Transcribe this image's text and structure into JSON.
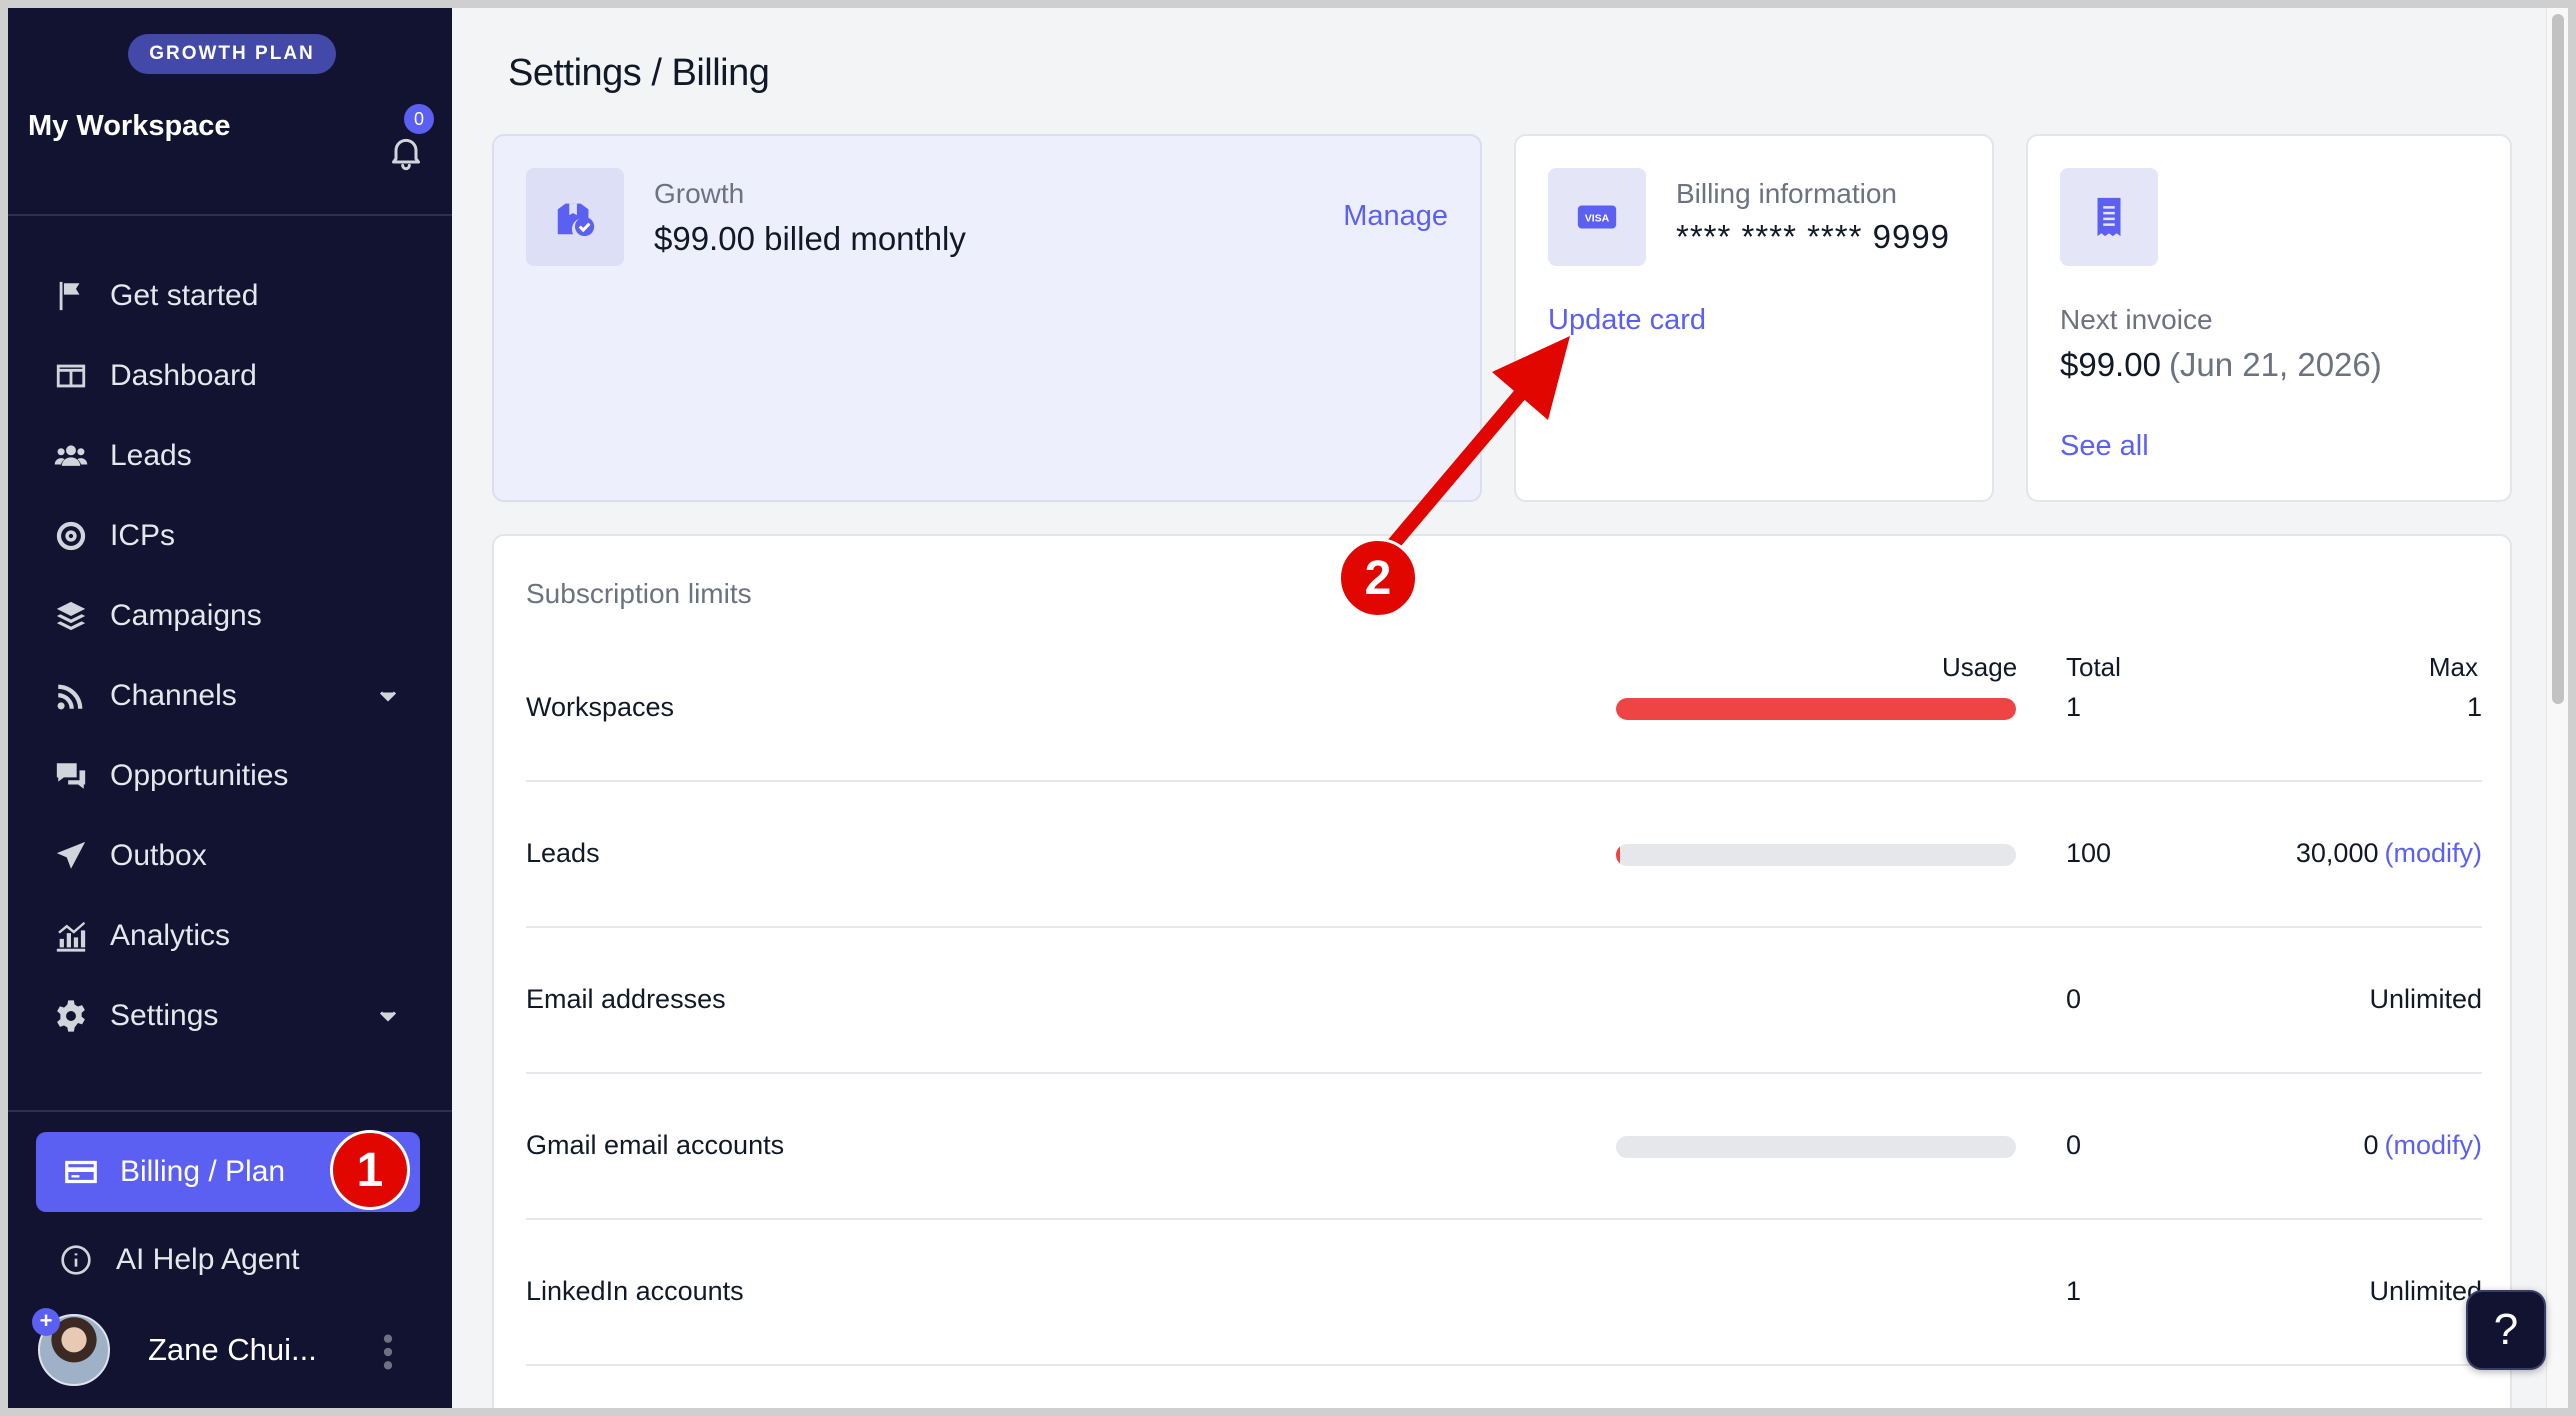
{
  "sidebar": {
    "plan_badge": "GROWTH PLAN",
    "workspace_name": "My Workspace",
    "notification_count": "0",
    "items": [
      {
        "label": "Get started",
        "icon": "flag-icon"
      },
      {
        "label": "Dashboard",
        "icon": "dashboard-icon"
      },
      {
        "label": "Leads",
        "icon": "users-icon"
      },
      {
        "label": "ICPs",
        "icon": "target-icon"
      },
      {
        "label": "Campaigns",
        "icon": "layers-icon"
      },
      {
        "label": "Channels",
        "icon": "rss-icon",
        "expandable": true
      },
      {
        "label": "Opportunities",
        "icon": "chat-icon"
      },
      {
        "label": "Outbox",
        "icon": "send-icon"
      },
      {
        "label": "Analytics",
        "icon": "analytics-icon"
      },
      {
        "label": "Settings",
        "icon": "gear-icon",
        "expandable": true
      }
    ],
    "billing_label": "Billing / Plan",
    "help_agent_label": "AI Help Agent",
    "user_name": "Zane Chui..."
  },
  "main": {
    "title": "Settings / Billing",
    "plan_card": {
      "plan_name": "Growth",
      "price": "$99.00 billed monthly",
      "manage_label": "Manage"
    },
    "billing_card": {
      "title": "Billing information",
      "card_number": "**** **** **** 9999",
      "update_label": "Update card"
    },
    "invoice_card": {
      "title": "Next invoice",
      "amount": "$99.00",
      "date": "(Jun 21, 2026)",
      "see_all_label": "See all"
    },
    "limits": {
      "title": "Subscription limits",
      "columns": {
        "usage": "Usage",
        "total": "Total",
        "max": "Max"
      },
      "rows": [
        {
          "label": "Workspaces",
          "usage": 1.0,
          "show_bar": true,
          "total": "1",
          "max": "1",
          "modify": ""
        },
        {
          "label": "Leads",
          "usage": 0.0033,
          "show_bar": true,
          "total": "100",
          "max": "30,000",
          "modify": "(modify)"
        },
        {
          "label": "Email addresses",
          "usage": 0,
          "show_bar": false,
          "total": "0",
          "max": "Unlimited",
          "modify": ""
        },
        {
          "label": "Gmail email accounts",
          "usage": 0,
          "show_bar": true,
          "total": "0",
          "max": "0",
          "modify": "(modify)"
        },
        {
          "label": "LinkedIn accounts",
          "usage": 0,
          "show_bar": false,
          "total": "1",
          "max": "Unlimited",
          "modify": ""
        }
      ]
    }
  },
  "help_fab": "?",
  "annotations": {
    "marker_1": "1",
    "marker_2": "2"
  },
  "colors": {
    "accent": "#5b5ff2",
    "sidebar_bg": "#111330",
    "usage_full": "#ef4444",
    "annotation": "#e10600"
  }
}
